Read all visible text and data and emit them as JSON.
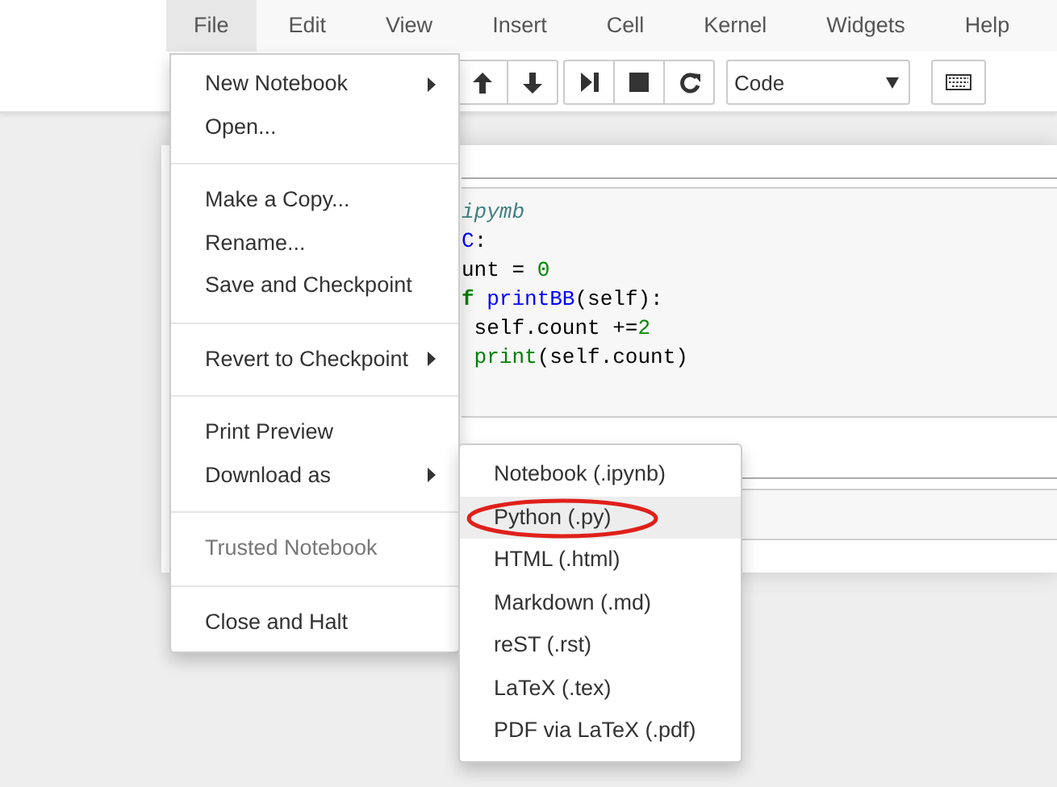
{
  "menubar": [
    {
      "label": "File",
      "selected": true
    },
    {
      "label": "Edit",
      "selected": false
    },
    {
      "label": "View",
      "selected": false
    },
    {
      "label": "Insert",
      "selected": false
    },
    {
      "label": "Cell",
      "selected": false
    },
    {
      "label": "Kernel",
      "selected": false
    },
    {
      "label": "Widgets",
      "selected": false
    },
    {
      "label": "Help",
      "selected": false
    }
  ],
  "toolbar": {
    "cell_type": {
      "value": "Code"
    }
  },
  "cells": [
    {
      "lines": [
        [
          {
            "text": "ipymb",
            "kind": "comment"
          }
        ],
        [
          {
            "text": "C",
            "kind": "def"
          },
          {
            "text": ":",
            "kind": "plain"
          }
        ],
        [
          {
            "text": "unt = ",
            "kind": "plain"
          },
          {
            "text": "0",
            "kind": "number"
          }
        ],
        [
          {
            "text": "f",
            "kind": "keyword"
          },
          {
            "text": " printBB",
            "kind": "def"
          },
          {
            "text": "(self):",
            "kind": "plain"
          }
        ],
        [
          {
            "text": " self.count +=",
            "kind": "plain"
          },
          {
            "text": "2",
            "kind": "number"
          }
        ],
        [
          {
            "text": " print",
            "kind": "builtin"
          },
          {
            "text": "(self.count)",
            "kind": "plain"
          }
        ]
      ]
    }
  ],
  "file_menu": {
    "sections": [
      [
        {
          "label": "New Notebook",
          "submenu": true,
          "disabled": false
        },
        {
          "label": "Open...",
          "submenu": false,
          "disabled": false
        }
      ],
      [
        {
          "label": "Make a Copy...",
          "submenu": false,
          "disabled": false
        },
        {
          "label": "Rename...",
          "submenu": false,
          "disabled": false
        },
        {
          "label": "Save and Checkpoint",
          "submenu": false,
          "disabled": false
        }
      ],
      [
        {
          "label": "Revert to Checkpoint",
          "submenu": true,
          "disabled": false
        }
      ],
      [
        {
          "label": "Print Preview",
          "submenu": false,
          "disabled": false
        },
        {
          "label": "Download as",
          "submenu": true,
          "disabled": false
        }
      ],
      [
        {
          "label": "Trusted Notebook",
          "submenu": false,
          "disabled": true
        }
      ],
      [
        {
          "label": "Close and Halt",
          "submenu": false,
          "disabled": false
        }
      ]
    ]
  },
  "download_submenu": [
    {
      "label": "Notebook (.ipynb)",
      "selected": false,
      "circled": false
    },
    {
      "label": "Python (.py)",
      "selected": true,
      "circled": true
    },
    {
      "label": "HTML (.html)",
      "selected": false,
      "circled": false
    },
    {
      "label": "Markdown (.md)",
      "selected": false,
      "circled": false
    },
    {
      "label": "reST (.rst)",
      "selected": false,
      "circled": false
    },
    {
      "label": "LaTeX (.tex)",
      "selected": false,
      "circled": false
    },
    {
      "label": "PDF via LaTeX (.pdf)",
      "selected": false,
      "circled": false
    }
  ]
}
